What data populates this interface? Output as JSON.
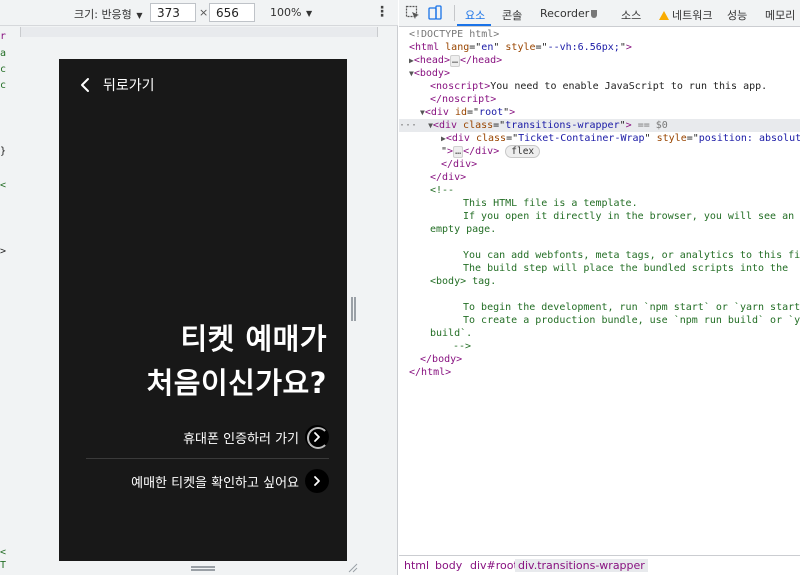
{
  "device_toolbar": {
    "dimensions_label": "크기: 반응형",
    "width_value": "373",
    "height_value": "656",
    "times": "×",
    "zoom": "100%",
    "more_icon": "kebab-menu-icon"
  },
  "app": {
    "back_label": "뒤로가기",
    "headline_line1": "티켓 예매가",
    "headline_line2": "처음이신가요?",
    "action1_label": "휴대폰 인증하러 가기",
    "action2_label": "예매한 티켓을 확인하고 싶어요",
    "colors": {
      "background": "#181818",
      "text": "#ffffff",
      "button": "#000000"
    }
  },
  "devtools": {
    "tabs": [
      "요소",
      "콘솔",
      "Recorder",
      "소스",
      "네트워크",
      "성능",
      "메모리"
    ],
    "active_tab": "요소",
    "accent": "#1a73e8",
    "tree": {
      "doctype": "<!DOCTYPE html>",
      "html_open_tag": "html",
      "html_lang_attr": "lang",
      "html_lang_val": "en",
      "html_style_attr": "style",
      "html_style_val": "--vh:6.56px;",
      "head": "head",
      "body": "body",
      "noscript": "noscript",
      "noscript_text": "You need to enable JavaScript to run this app.",
      "div": "div",
      "id_attr": "id",
      "root_val": "root",
      "class_attr": "class",
      "wrapper_val": "transitions-wrapper",
      "selected_marker": "== $0",
      "ticket_val": "Ticket-Container-Wrap",
      "style_attr": "style",
      "ticket_style_val": "position: absolute;",
      "flex_badge": "flex",
      "comment_open": "<!--",
      "comment_lines": [
        "This HTML file is a template.",
        "If you open it directly in the browser, you will see an",
        "empty page.",
        "",
        "You can add webfonts, meta tags, or analytics to this file.",
        "The build step will place the bundled scripts into the",
        "<body> tag.",
        "",
        "To begin the development, run `npm start` or `yarn start`.",
        "To create a production bundle, use `npm run build` or `yarn",
        "build`."
      ],
      "comment_close": "-->"
    },
    "breadcrumbs": [
      "html",
      "body",
      "div#root",
      "div.transitions-wrapper"
    ]
  }
}
